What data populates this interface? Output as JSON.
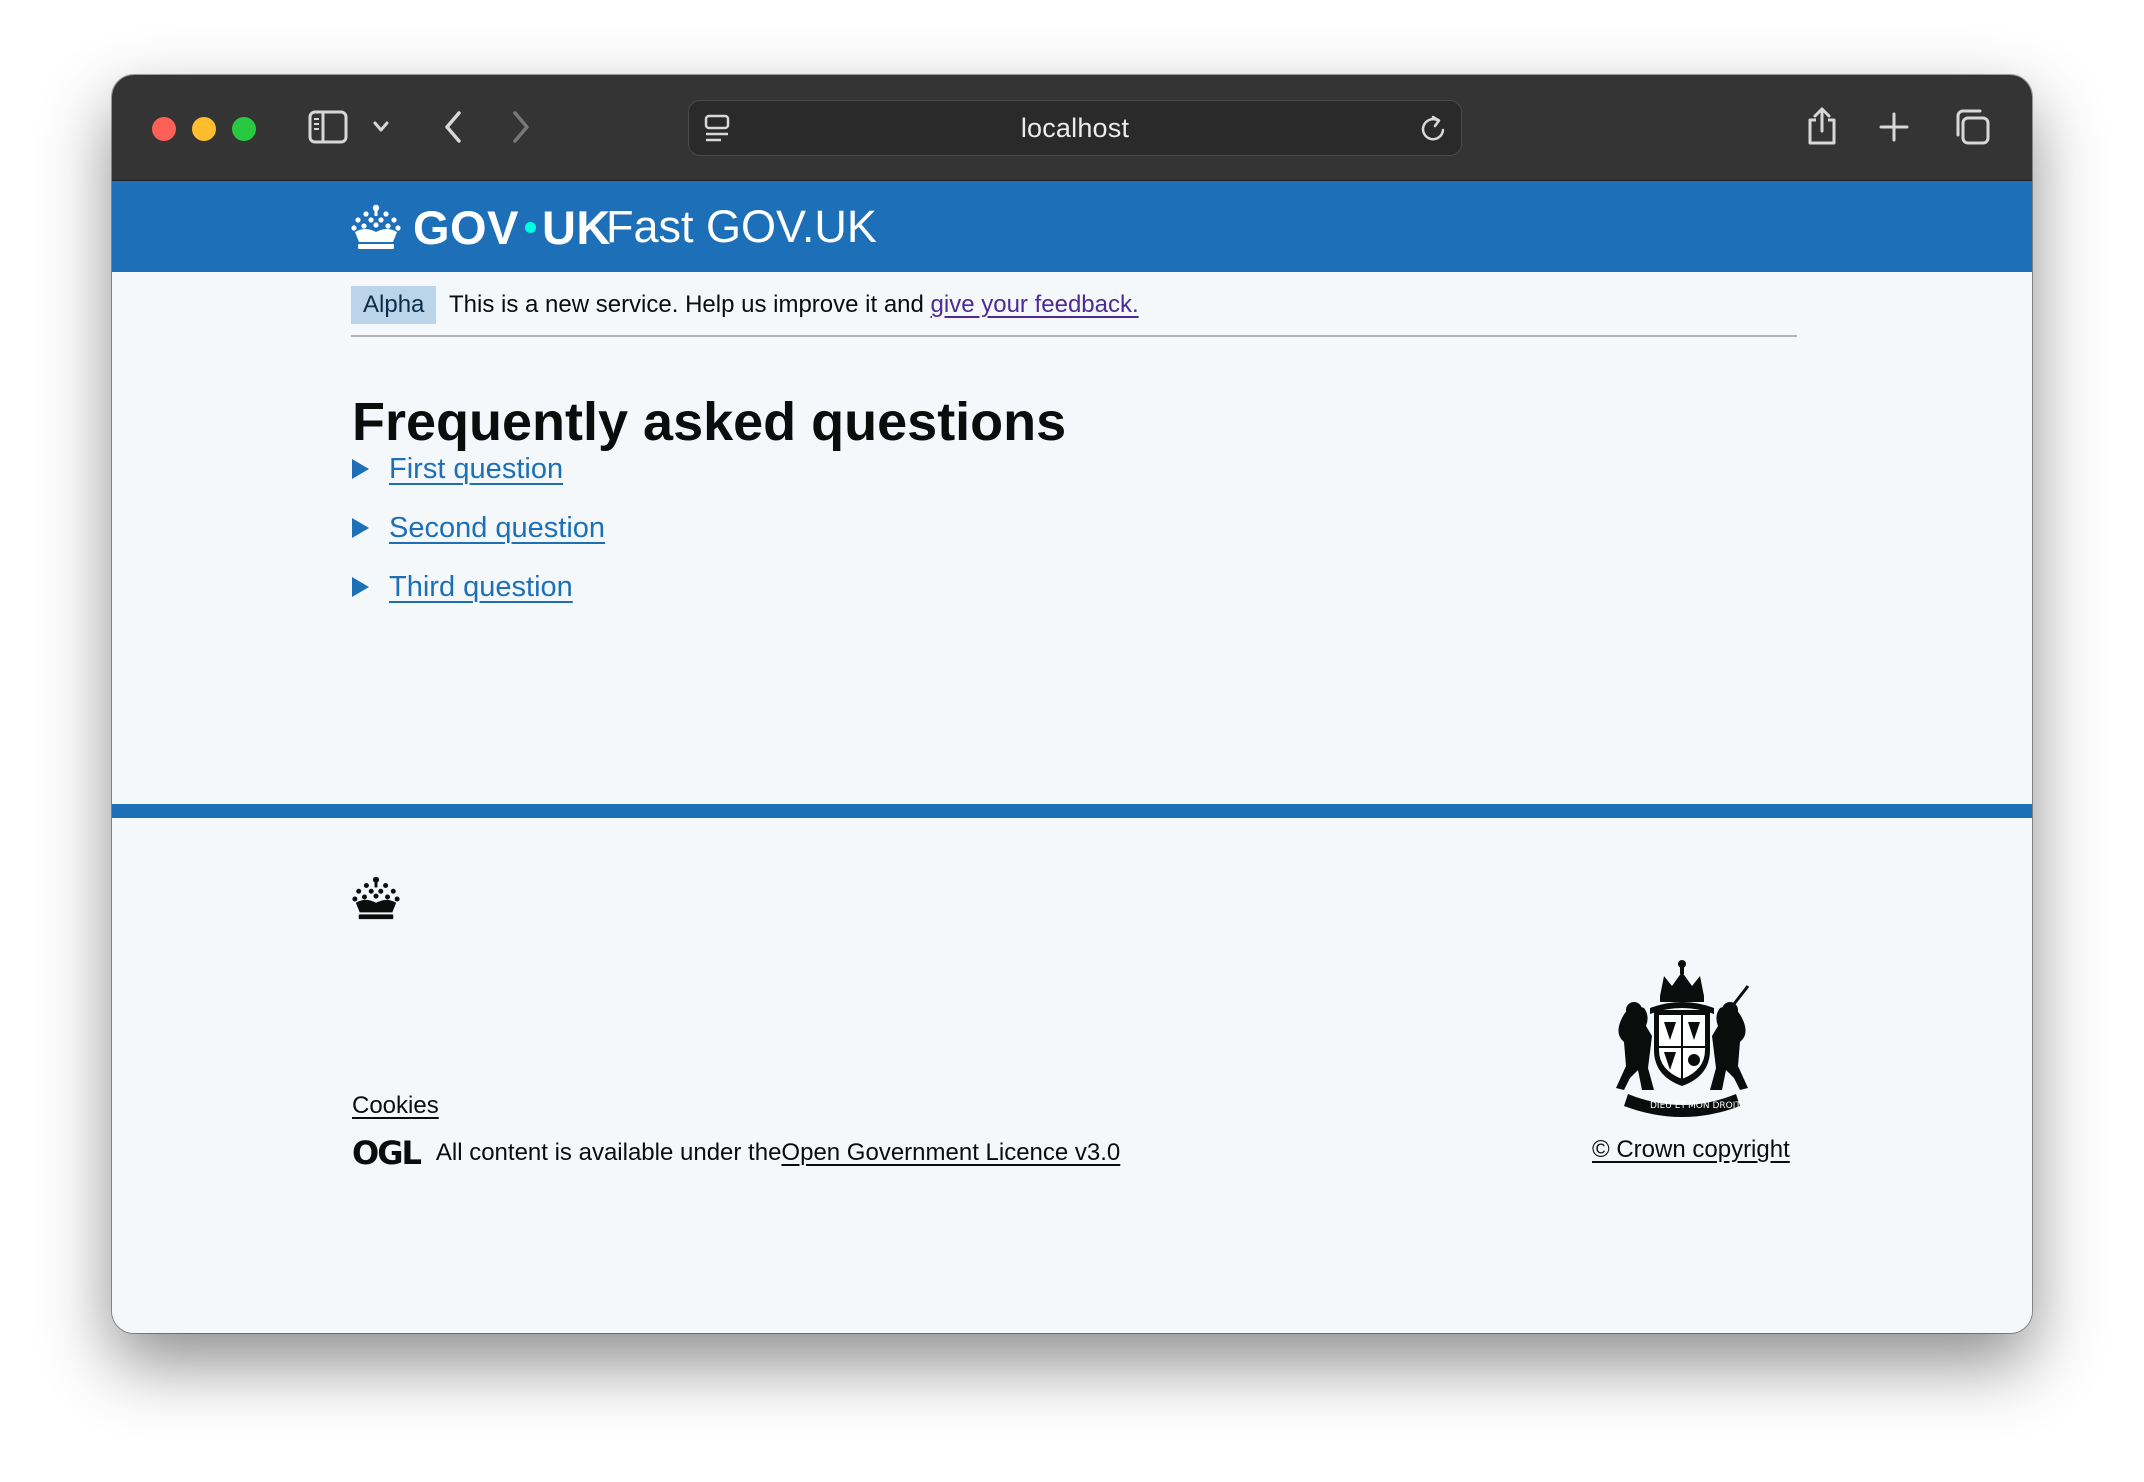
{
  "browser": {
    "url": "localhost"
  },
  "header": {
    "logo_text_left": "GOV",
    "logo_text_right": "UK",
    "service_name": "Fast GOV.UK"
  },
  "phase_banner": {
    "tag": "Alpha",
    "text": "This is a new service. Help us improve it and ",
    "link_text": "give your feedback."
  },
  "main": {
    "title": "Frequently asked questions",
    "questions": [
      {
        "label": "First question"
      },
      {
        "label": "Second question"
      },
      {
        "label": "Third question"
      }
    ]
  },
  "footer": {
    "cookies_link": "Cookies",
    "ogl_logo": "OGL",
    "licence_text": "All content is available under the",
    "licence_link": "Open Government Licence v3.0",
    "copyright_link": "© Crown copyright",
    "coat_of_arms_motto_left": "DIEU ET",
    "coat_of_arms_motto_right": "MON DROIT"
  },
  "colors": {
    "brand_blue": "#1d70b8",
    "toolbar": "#343434",
    "visited_link": "#4c2c92",
    "phase_tag_bg": "#bbd4ea",
    "page_bg": "#f4f8fb"
  },
  "icons": {
    "sidebar": "sidebar-icon",
    "chevron_down": "chevron-down-icon",
    "back": "back-arrow-icon",
    "forward": "forward-arrow-icon",
    "page_settings": "page-settings-icon",
    "reload": "reload-icon",
    "share": "share-icon",
    "new_tab": "plus-icon",
    "tab_overview": "tab-overview-icon",
    "crown": "crown-icon",
    "coat_of_arms": "coat-of-arms-icon"
  }
}
